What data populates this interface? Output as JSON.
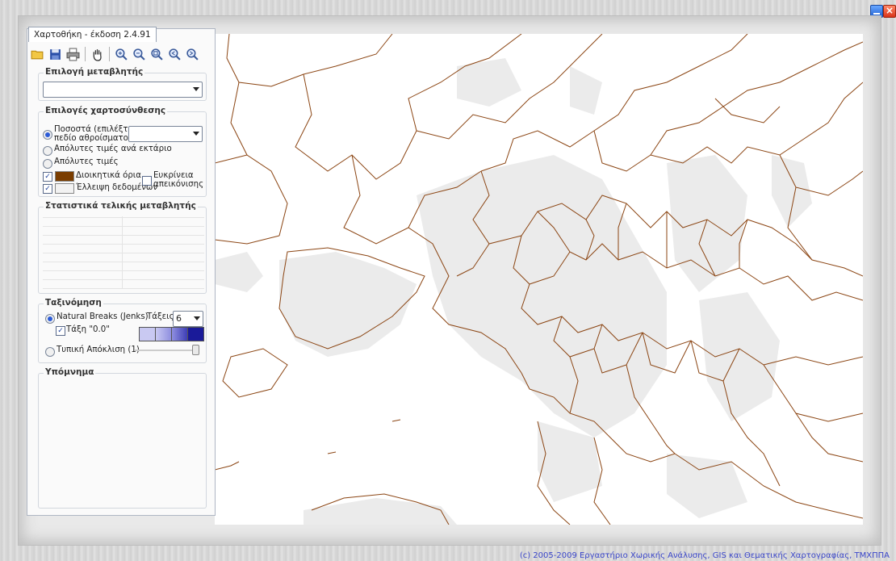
{
  "app": {
    "title": "Χαρτοθήκη - έκδοση 2.4.91"
  },
  "toolbar": {
    "icons": [
      "folder-open-icon",
      "save-icon",
      "print-icon",
      "pan-hand-icon",
      "zoom-in-icon",
      "zoom-out-icon",
      "zoom-extent-icon",
      "zoom-previous-icon",
      "zoom-next-icon"
    ]
  },
  "variable": {
    "title": "Επιλογή μεταβλητής",
    "value": ""
  },
  "options": {
    "title": "Επιλογές χαρτοσύνθεσης",
    "percent_line1": "Ποσοστά (επιλέξτε",
    "percent_line2": "πεδίο αθροίσματος)",
    "percent_selected": true,
    "percent_combo_value": "",
    "absolute_per_hectare": "Απόλυτες τιμές ανά εκτάριο",
    "absolute": "Απόλυτες τιμές",
    "admin_bounds": "Διοικητικά όρια",
    "admin_color": "#7a3d00",
    "missing_data": "Έλλειψη δεδομένων",
    "missing_color": "#f2f2f2",
    "clear_line1": "Ευκρίνεια",
    "clear_line2": "απεικόνισης"
  },
  "stats": {
    "title": "Στατιστικά τελικής μεταβλητής"
  },
  "classification": {
    "title": "Ταξινόμηση",
    "natural_breaks": "Natural Breaks (Jenks)",
    "classes_label": "Τάξεις:",
    "classes_value": "6",
    "class_zero": "Τάξη \"0.0\"",
    "std_dev": "Τυπική Απόκλιση (1)",
    "ramp_colors": [
      "#c9c9f2",
      "#b6b6ec",
      "#7b7bd8",
      "#3e3eb6",
      "#1a1a99",
      "#05056e"
    ]
  },
  "legend": {
    "title": "Υπόμνημα"
  },
  "footer": {
    "text": "(c) 2005-2009 Εργαστήριο Χωρικής Ανάλυσης, GIS και Θεματικής Χαρτογραφίας, ΤΜΧΠΠΑ"
  },
  "map": {
    "boundary_color": "#8b4513",
    "land_color": "#ebebeb"
  }
}
